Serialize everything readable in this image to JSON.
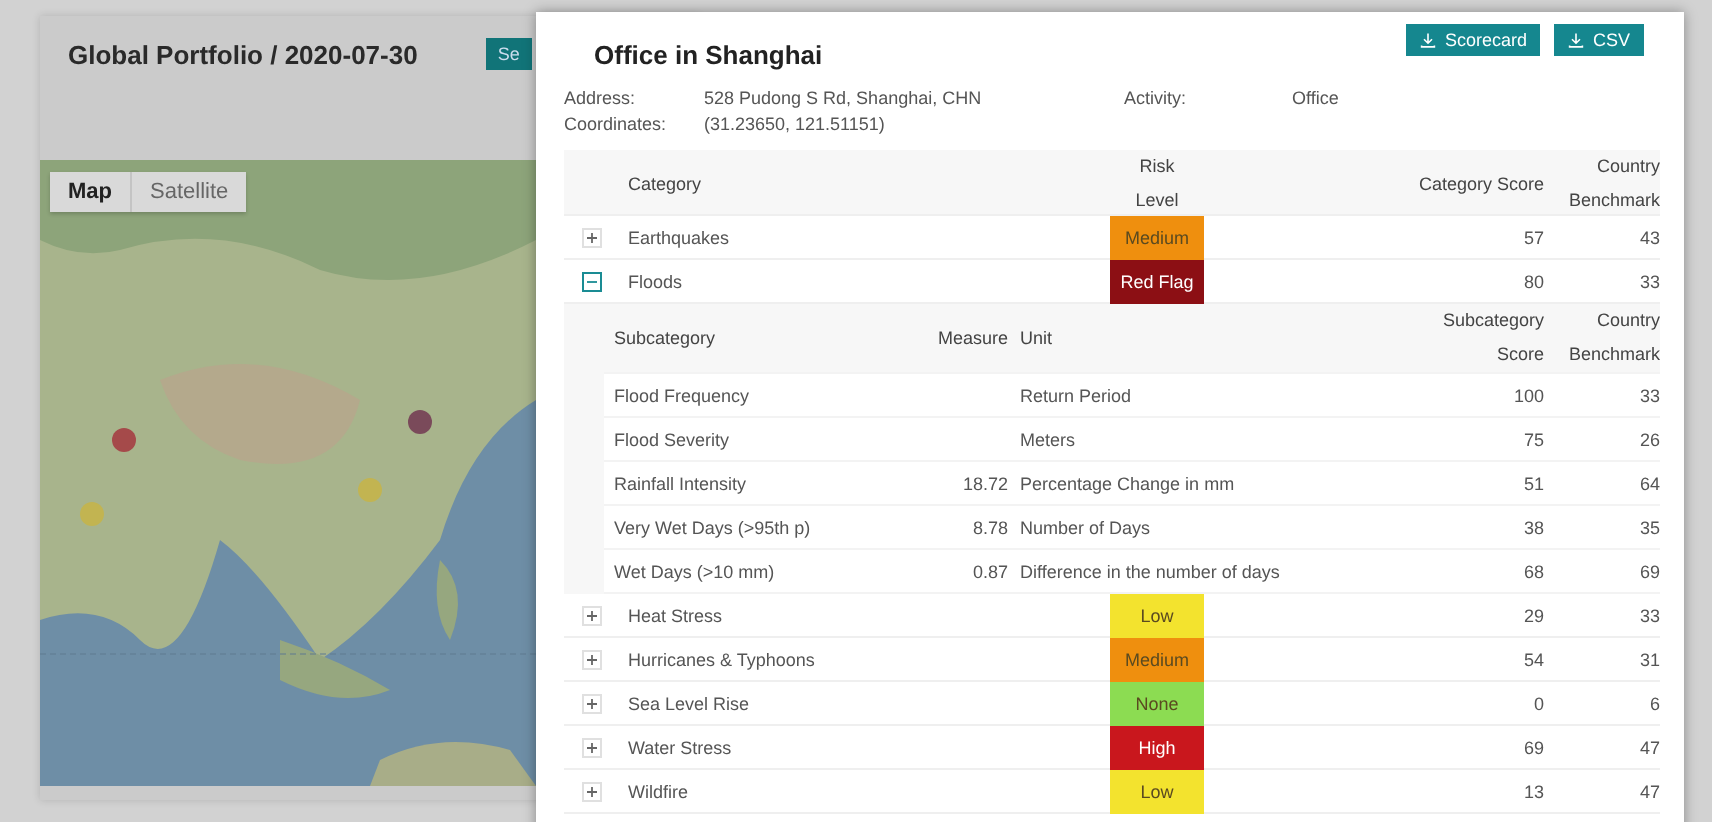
{
  "page": {
    "title": "Global Portfolio / 2020-07-30",
    "button": "Se",
    "map": {
      "toggle": [
        {
          "label": "Map",
          "selected": true
        },
        {
          "label": "Satellite",
          "selected": false
        }
      ]
    }
  },
  "modal": {
    "title": "Office in Shanghai",
    "actions": [
      "Scorecard",
      "CSV"
    ],
    "details": [
      {
        "label": "Address:",
        "value": "528 Pudong S Rd, Shanghai, CHN"
      },
      {
        "label": "Coordinates:",
        "value": "(31.23650, 121.51151)"
      },
      {
        "label": "Activity:",
        "value": "Office"
      }
    ],
    "table": {
      "columns": [
        "Category",
        "Risk Level",
        "Category Score",
        "Country Benchmark"
      ],
      "rows": [
        {
          "category": "Earthquakes",
          "risk": "Medium",
          "color": "#ef8f0e",
          "score": "57",
          "benchmark": "43",
          "expanded": false
        },
        {
          "category": "Floods",
          "risk": "Red Flag",
          "color": "#8c0f14",
          "score": "80",
          "benchmark": "33",
          "expanded": true,
          "subtable": {
            "columns": [
              "Subcategory",
              "Measure",
              "Unit",
              "Subcategory Score",
              "Country Benchmark"
            ],
            "rows": [
              {
                "subcategory": "Flood Frequency",
                "measure": "",
                "unit": "Return Period",
                "score": "100",
                "benchmark": "33"
              },
              {
                "subcategory": "Flood Severity",
                "measure": "",
                "unit": "Meters",
                "score": "75",
                "benchmark": "26"
              },
              {
                "subcategory": "Rainfall Intensity",
                "measure": "18.72",
                "unit": "Percentage Change in mm",
                "score": "51",
                "benchmark": "64"
              },
              {
                "subcategory": "Very Wet Days (>95th p)",
                "measure": "8.78",
                "unit": "Number of Days",
                "score": "38",
                "benchmark": "35"
              },
              {
                "subcategory": "Wet Days (>10 mm)",
                "measure": "0.87",
                "unit": "Difference in the number of days",
                "score": "68",
                "benchmark": "69"
              }
            ]
          }
        },
        {
          "category": "Heat Stress",
          "risk": "Low",
          "color": "#f3e32e",
          "score": "29",
          "benchmark": "33",
          "expanded": false
        },
        {
          "category": "Hurricanes & Typhoons",
          "risk": "Medium",
          "color": "#ef8f0e",
          "score": "54",
          "benchmark": "31",
          "expanded": false
        },
        {
          "category": "Sea Level Rise",
          "risk": "None",
          "color": "#8cdc52",
          "score": "0",
          "benchmark": "6",
          "expanded": false
        },
        {
          "category": "Water Stress",
          "risk": "High",
          "color": "#c9171d",
          "score": "69",
          "benchmark": "47",
          "expanded": false
        },
        {
          "category": "Wildfire",
          "risk": "Low",
          "color": "#f3e32e",
          "score": "13",
          "benchmark": "47",
          "expanded": false
        }
      ]
    }
  }
}
